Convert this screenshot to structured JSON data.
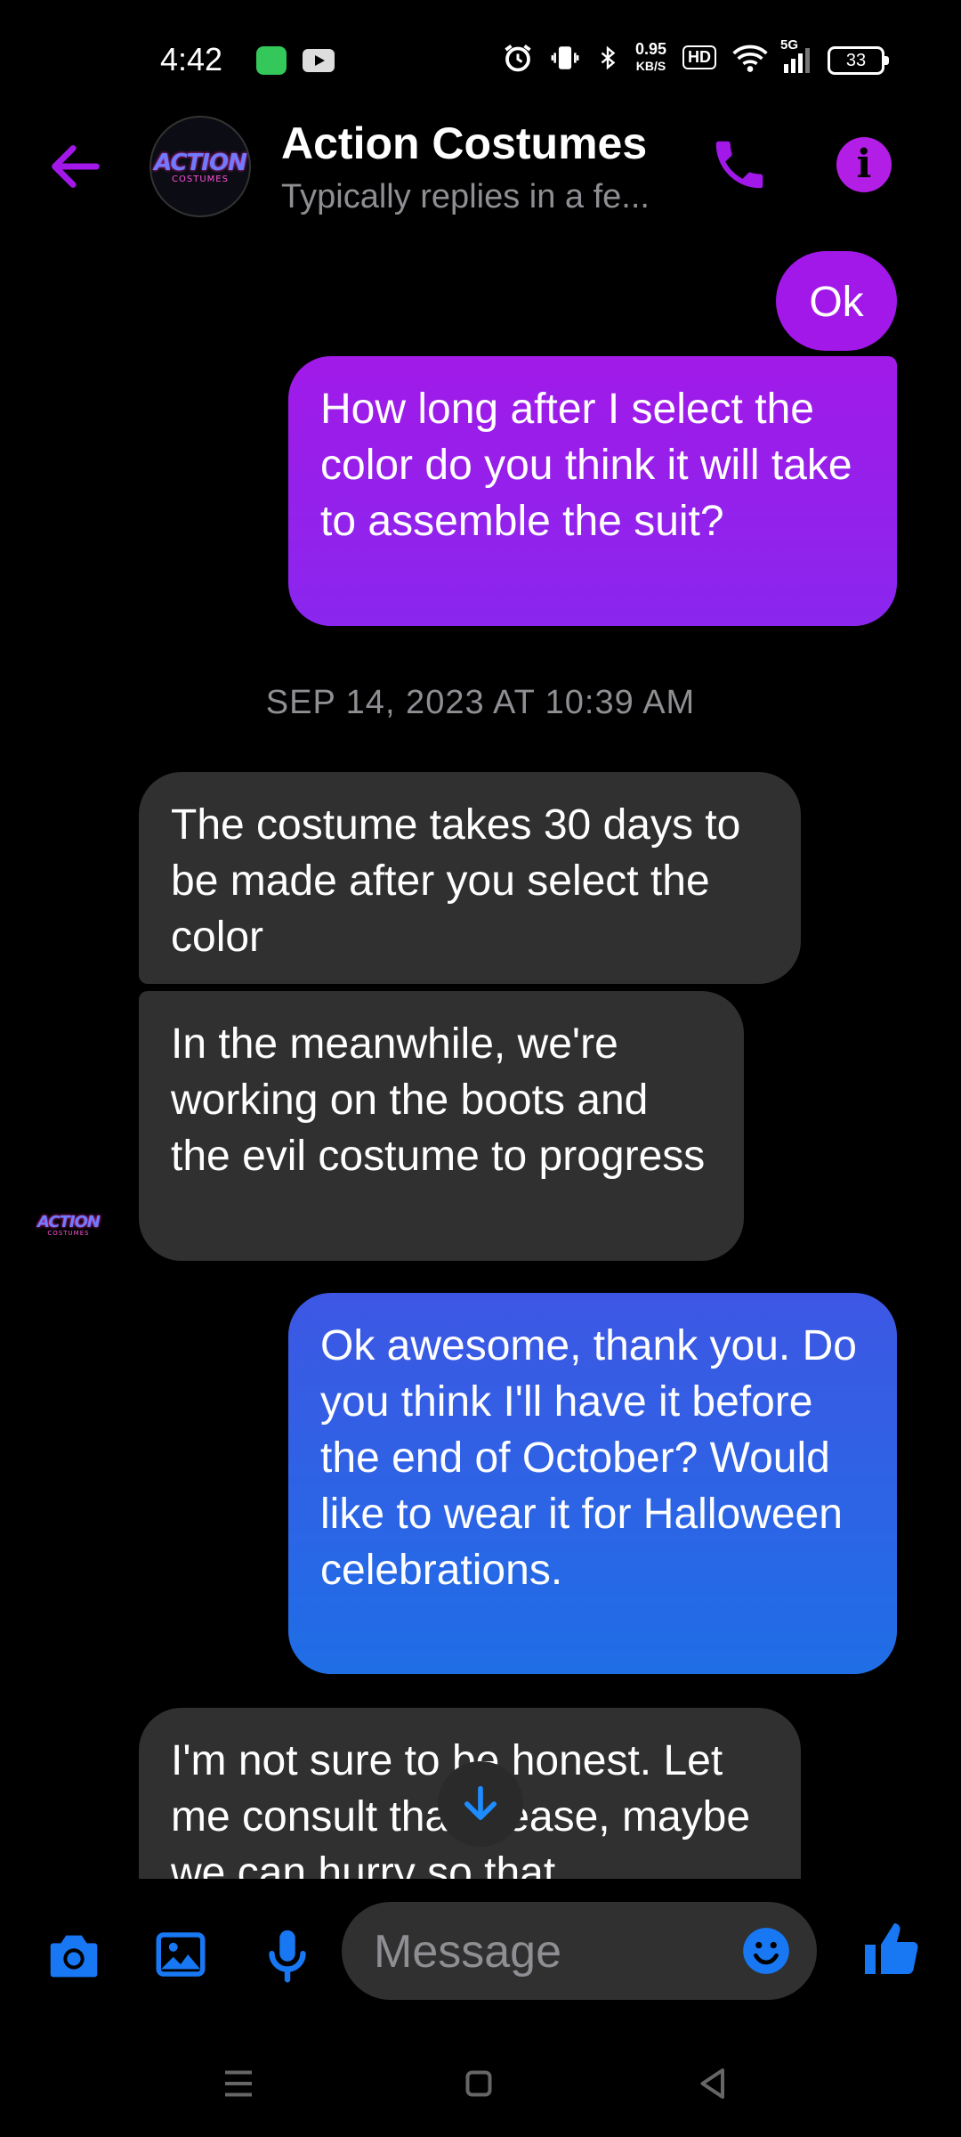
{
  "status_bar": {
    "time": "4:42",
    "net_speed_value": "0.95",
    "net_speed_unit": "KB/S",
    "hd_label": "HD",
    "network_label": "5G",
    "battery": "33"
  },
  "header": {
    "title": "Action Costumes",
    "subtitle": "Typically replies in a fe...",
    "logo_word": "ACTION",
    "logo_sub": "COSTUMES"
  },
  "messages": {
    "out_ok": "Ok",
    "out_1": "How long after I select the color do you think it will take to assemble the suit?",
    "timestamp": "SEP 14, 2023 AT 10:39 AM",
    "in_1": "The costume takes 30 days to be made after you select the color",
    "in_2": "In the meanwhile, we're working on the boots and the evil costume to progress",
    "out_2": "Ok awesome, thank you. Do you think I'll have it before the end of October? Would like to wear it for Halloween celebrations.",
    "in_3": "I'm not sure to be honest. Let me consult that please, maybe we can hurry so that"
  },
  "composer": {
    "placeholder": "Message"
  },
  "colors": {
    "accent_purple": "#a118e8",
    "outgoing_blue": "#2a64e6",
    "incoming_gray": "#303030",
    "messenger_blue": "#1877f2"
  }
}
